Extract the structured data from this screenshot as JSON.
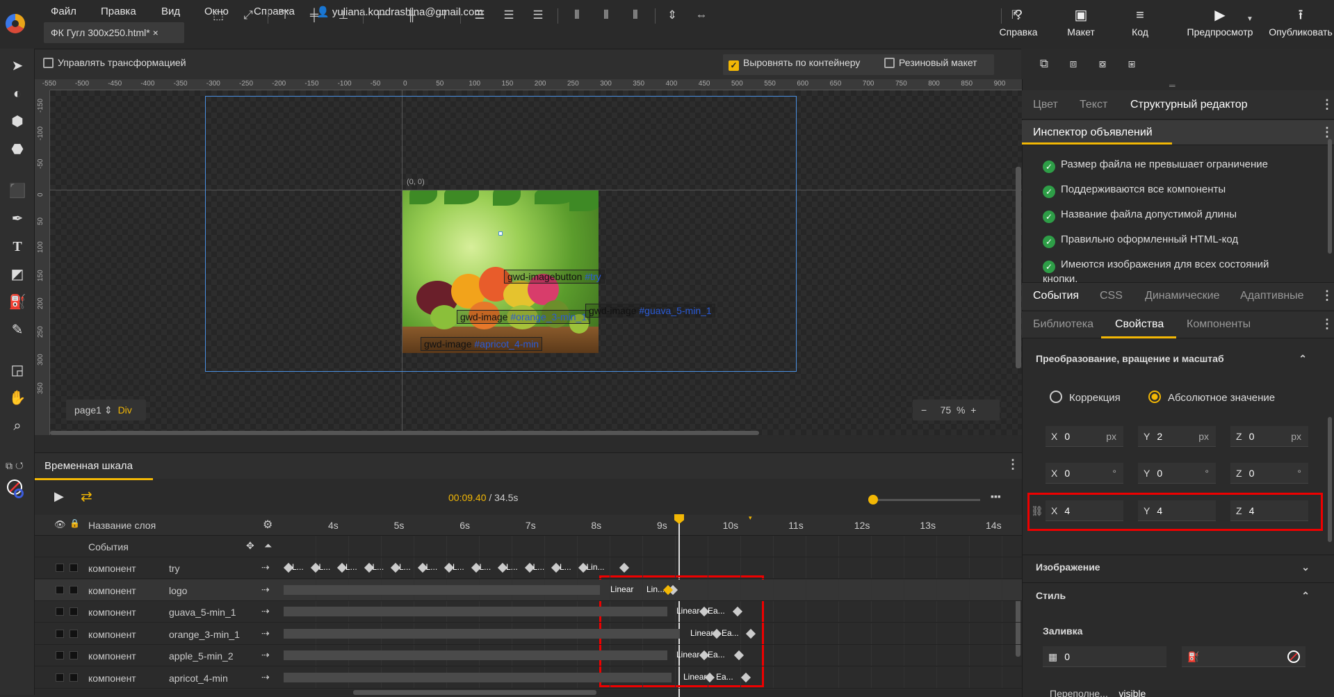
{
  "menu": {
    "file": "Файл",
    "edit": "Правка",
    "view": "Вид",
    "window": "Окно",
    "help": "Справка",
    "user": "yuliana.kondrashina@gmail.com"
  },
  "file_tab": {
    "name": "ФК Гугл 300x250.html*",
    "close": "×"
  },
  "top_right": {
    "help": "Справка",
    "layout": "Макет",
    "code": "Код",
    "preview": "Предпросмотр",
    "publish": "Опубликовать"
  },
  "toolbar": {
    "transform_label": "Управлять трансформацией",
    "align_container": "Выровнять по контейнеру",
    "rubber_layout": "Резиновый макет",
    "align_checked": true,
    "transform_checked": false,
    "rubber_checked": false
  },
  "rulers": {
    "h": [
      "-550",
      "-500",
      "-450",
      "-400",
      "-350",
      "-300",
      "-250",
      "-200",
      "-150",
      "-100",
      "-50",
      "0",
      "50",
      "100",
      "150",
      "200",
      "250",
      "300",
      "350",
      "400",
      "450",
      "500",
      "550",
      "600",
      "650",
      "700",
      "750",
      "800",
      "850",
      "900"
    ],
    "v": [
      "-150",
      "-100",
      "-50",
      "0",
      "50",
      "100",
      "150",
      "200",
      "250",
      "300",
      "350"
    ]
  },
  "stage": {
    "origin": "(0, 0)",
    "labels": [
      {
        "type": "gwd-imagebutton",
        "id": "#try"
      },
      {
        "type": "gwd-image",
        "id": "#orange_3-min_1"
      },
      {
        "type": "gwd-image",
        "id": "#guava_5-min_1"
      },
      {
        "type": "gwd-image",
        "id": "#apricot_4-min"
      }
    ],
    "page": "page1",
    "page_type": "Div",
    "zoom_value": "75",
    "zoom_unit": "%",
    "zoom_minus": "−",
    "zoom_plus": "+"
  },
  "timeline": {
    "title": "Временная шкала",
    "time_current": "00:09.40",
    "time_total": " / 34.5s",
    "layer_name_header": "Название слоя",
    "events_label": "События",
    "ticks": [
      "4s",
      "5s",
      "6s",
      "7s",
      "8s",
      "9s",
      "10s",
      "11s",
      "12s",
      "13s",
      "14s"
    ],
    "layers": [
      {
        "kind": "компонент",
        "name": "try"
      },
      {
        "kind": "компонент",
        "name": "logo"
      },
      {
        "kind": "компонент",
        "name": "guava_5-min_1"
      },
      {
        "kind": "компонент",
        "name": "orange_3-min_1"
      },
      {
        "kind": "компонент",
        "name": "apple_5-min_2"
      },
      {
        "kind": "компонент",
        "name": "apricot_4-min"
      }
    ],
    "row_try_labels": [
      "L...",
      "L...",
      "L...",
      "L...",
      "L...",
      "L...",
      "L...",
      "L...",
      "L...",
      "L...",
      "L...",
      "Lin..."
    ],
    "row_logo_labels": [
      "Linear",
      "Lin..."
    ],
    "row_guava_labels": [
      "Linear",
      "Ea..."
    ],
    "row_orange_labels": [
      "Linear",
      "Ea..."
    ],
    "row_apple_labels": [
      "Linear",
      "Ea..."
    ],
    "row_apricot_labels": [
      "Linear",
      "Ea..."
    ]
  },
  "right": {
    "tabs1": [
      "Цвет",
      "Текст",
      "Структурный редактор"
    ],
    "inspector_title": "Инспектор объявлений",
    "checks": [
      "Размер файла не превышает ограничение",
      "Поддерживаются все компоненты",
      "Название файла допустимой длины",
      "Правильно оформленный HTML-код",
      "Имеются изображения для всех состояний кнопки."
    ],
    "tabs2": [
      "События",
      "CSS",
      "Динамические",
      "Адаптивные"
    ],
    "tabs3": [
      "Библиотека",
      "Свойства",
      "Компоненты"
    ],
    "transform_section": "Преобразование, вращение и масштаб",
    "radio_correction": "Коррекция",
    "radio_absolute": "Абсолютное значение",
    "pos": {
      "x": "0",
      "y": "2",
      "z": "0",
      "unit": "px"
    },
    "rot": {
      "x": "0",
      "y": "0",
      "z": "0",
      "unit": "°"
    },
    "scale": {
      "x": "4",
      "y": "4",
      "z": "4"
    },
    "axis": {
      "x": "X",
      "y": "Y",
      "z": "Z"
    },
    "image_section": "Изображение",
    "style_section": "Стиль",
    "fill_label": "Заливка",
    "fill_value": "0",
    "overflow_label": "Переполне...",
    "overflow_value": "visible"
  }
}
